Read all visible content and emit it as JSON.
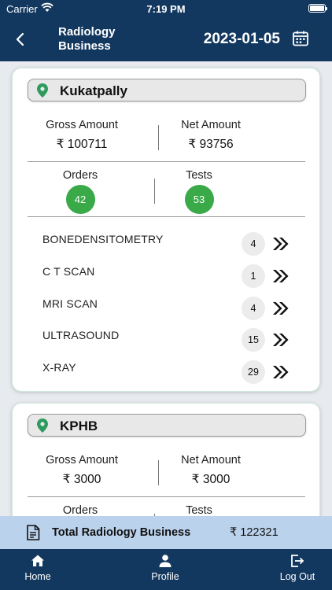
{
  "status_bar": {
    "carrier": "Carrier",
    "time": "7:19 PM"
  },
  "header": {
    "title": "Radiology Business",
    "date": "2023-01-05"
  },
  "locations": [
    {
      "name": "Kukatpally",
      "gross_label": "Gross Amount",
      "gross_value": "₹ 100711",
      "net_label": "Net Amount",
      "net_value": "₹ 93756",
      "orders_label": "Orders",
      "orders_value": "42",
      "tests_label": "Tests",
      "tests_value": "53",
      "items": [
        {
          "name": "BONEDENSITOMETRY",
          "count": "4"
        },
        {
          "name": "C T SCAN",
          "count": "1"
        },
        {
          "name": "MRI SCAN",
          "count": "4"
        },
        {
          "name": "ULTRASOUND",
          "count": "15"
        },
        {
          "name": "X-RAY",
          "count": "29"
        }
      ]
    },
    {
      "name": "KPHB",
      "gross_label": "Gross Amount",
      "gross_value": "₹ 3000",
      "net_label": "Net Amount",
      "net_value": "₹ 3000",
      "orders_label": "Orders",
      "tests_label": "Tests"
    }
  ],
  "total": {
    "label": "Total Radiology Business",
    "value": "₹ 122321"
  },
  "tabs": {
    "home": "Home",
    "profile": "Profile",
    "logout": "Log Out"
  },
  "icons": [
    "wifi-icon",
    "battery-icon",
    "back-chevron-icon",
    "calendar-icon",
    "location-pin-icon",
    "double-chevron-right-icon",
    "document-icon",
    "home-icon",
    "person-icon",
    "logout-icon"
  ],
  "colors": {
    "primary": "#13385f",
    "accent_green": "#3aa948",
    "pin_green": "#2e9b5e",
    "total_bar": "#bbd2ec"
  }
}
